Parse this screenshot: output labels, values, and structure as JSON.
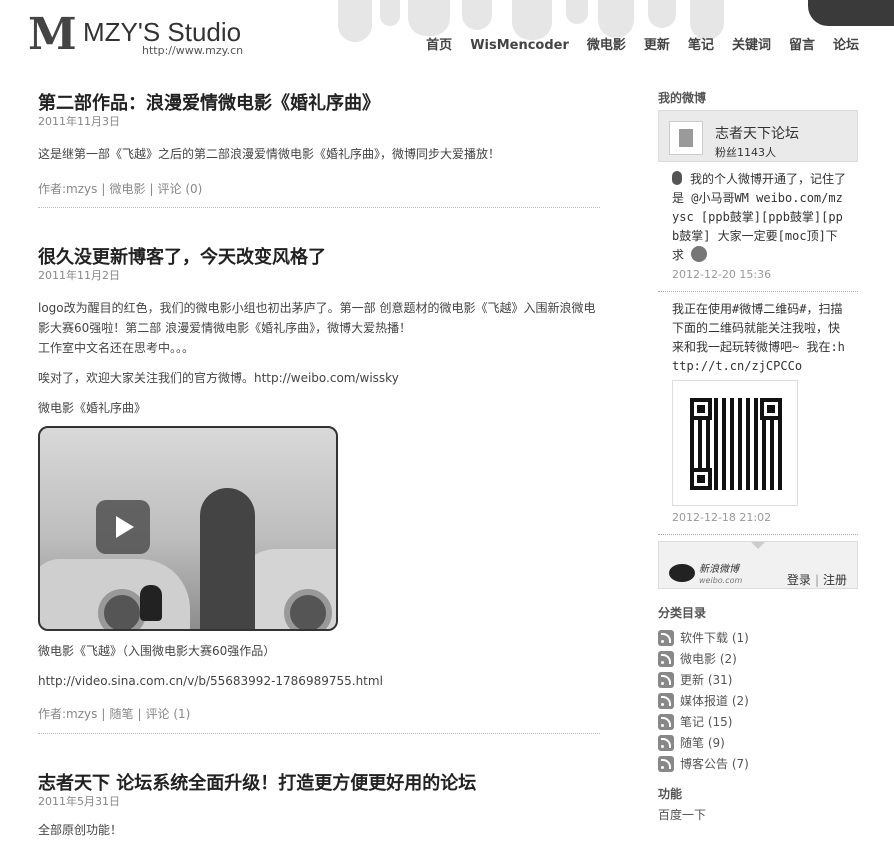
{
  "header": {
    "logo_mark": "M",
    "site_name": "MZY'S Studio",
    "site_url": "http://www.mzy.cn",
    "nav": [
      "首页",
      "WisMencoder",
      "微电影",
      "更新",
      "笔记",
      "关键词",
      "留言",
      "论坛"
    ]
  },
  "posts": [
    {
      "title": "第二部作品：浪漫爱情微电影《婚礼序曲》",
      "date": "2011年11月3日",
      "body": [
        "这是继第一部《飞越》之后的第二部浪漫爱情微电影《婚礼序曲》，微博同步大爱播放！"
      ],
      "meta": {
        "author": "作者:mzys",
        "category": "微电影",
        "comments": "评论 (0)"
      }
    },
    {
      "title": "很久没更新博客了，今天改变风格了",
      "date": "2011年11月2日",
      "body": [
        "logo改为醒目的红色，我们的微电影小组也初出茅庐了。第一部 创意题材的微电影《飞越》入围新浪微电影大赛60强啦！第二部 浪漫爱情微电影《婚礼序曲》，微博大爱热播！",
        "工作室中文名还在思考中。。。",
        "唉对了，欢迎大家关注我们的官方微博。http://weibo.com/wissky",
        "微电影《婚礼序曲》",
        "微电影《飞越》（入围微电影大赛60强作品）",
        "http://video.sina.com.cn/v/b/55683992-1786989755.html"
      ],
      "meta": {
        "author": "作者:mzys",
        "category": "随笔",
        "comments": "评论 (1)"
      }
    },
    {
      "title": "志者天下 论坛系统全面升级！打造更方便更好用的论坛",
      "date": "2011年5月31日",
      "body": [
        "全部原创功能！"
      ]
    }
  ],
  "sidebar": {
    "weibo_title": "我的微博",
    "weibo_name": "志者天下论坛",
    "weibo_fans": "粉丝1143人",
    "weibo_posts": [
      {
        "text": "我的个人微博开通了，记住了是 @小马哥WM weibo.com/mzysc [ppb鼓掌][ppb鼓掌][ppb鼓掌] 大家一定要[moc顶]下 求",
        "time": "2012-12-20 15:36"
      },
      {
        "text": "我正在使用#微博二维码#，扫描下面的二维码就能关注我啦，快来和我一起玩转微博吧~ 我在:http://t.cn/zjCPCCo",
        "time": "2012-12-18 21:02"
      }
    ],
    "weibo_brand": "新浪微博",
    "weibo_brand_url": "weibo.com",
    "login": "登录",
    "register": "注册",
    "categories_title": "分类目录",
    "categories": [
      "软件下载 (1)",
      "微电影 (2)",
      "更新 (31)",
      "媒体报道 (2)",
      "笔记 (15)",
      "随笔 (9)",
      "博客公告 (7)"
    ],
    "functions_title": "功能",
    "functions_first": "百度一下"
  }
}
